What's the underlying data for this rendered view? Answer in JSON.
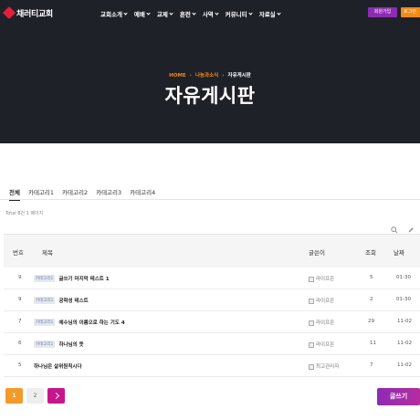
{
  "header": {
    "logo_text": "채러티교회",
    "nav": [
      "교회소개",
      "예배",
      "교제",
      "훈련",
      "사역",
      "커뮤니티",
      "자료실"
    ],
    "join_label": "회원가입",
    "login_label": "로그인"
  },
  "hero": {
    "breadcrumb": {
      "home": "HOME",
      "middle": "나눔과소식",
      "current": "자유게시판"
    },
    "title": "자유게시판"
  },
  "tabs": [
    "전체",
    "카테고리1",
    "카테고리2",
    "카테고리3",
    "카테고리4"
  ],
  "active_tab": 0,
  "total_text": "Total 8건 1 페이지",
  "table": {
    "headers": {
      "num": "번호",
      "subject": "제목",
      "writer": "글쓴이",
      "views": "조회",
      "date": "날짜"
    },
    "rows": [
      {
        "num": "9",
        "category": "카테고리1",
        "subject": "글쓰기 마지막 테스트 1",
        "writer": "라이프온",
        "views": "5",
        "date": "01-30"
      },
      {
        "num": "9",
        "category": "카테고리1",
        "subject": "공학성 테스트",
        "writer": "라이프온",
        "views": "2",
        "date": "01-30"
      },
      {
        "num": "7",
        "category": "카테고리1",
        "subject": "예수님의 이름으로 하는 기도 4",
        "writer": "라이프온",
        "views": "29",
        "date": "11-02"
      },
      {
        "num": "6",
        "category": "카테고리1",
        "subject": "하나님의 뜻",
        "writer": "라이프온",
        "views": "11",
        "date": "11-02"
      },
      {
        "num": "5",
        "category": "",
        "subject": "하나님은 살위원칙시다",
        "writer": "최고관리자",
        "views": "7",
        "date": "11-02"
      }
    ]
  },
  "pagination": {
    "pages": [
      "1",
      "2"
    ],
    "current": "1"
  },
  "write_label": "글쓰기",
  "icons": {
    "search": "search-icon",
    "edit": "pencil-icon",
    "next": "chevron-right-icon",
    "logo": "logo-mark-icon"
  },
  "colors": {
    "accent_orange": "#f18b18",
    "accent_purple": "#8e2bb5",
    "accent_magenta": "#c7168c",
    "hero_bg": "#1f2129"
  }
}
